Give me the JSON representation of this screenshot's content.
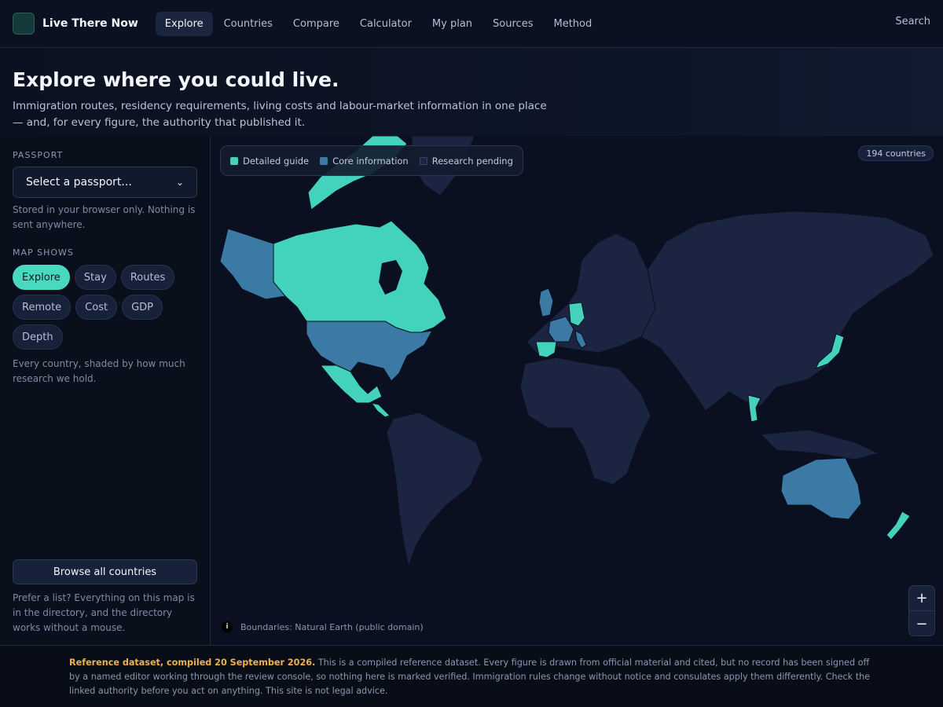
{
  "app": {
    "name": "Live There Now"
  },
  "nav": {
    "items": [
      {
        "label": "Explore",
        "active": true
      },
      {
        "label": "Countries",
        "active": false
      },
      {
        "label": "Compare",
        "active": false
      },
      {
        "label": "Calculator",
        "active": false
      },
      {
        "label": "My plan",
        "active": false
      },
      {
        "label": "Sources",
        "active": false
      },
      {
        "label": "Method",
        "active": false
      }
    ],
    "search_label": "Search"
  },
  "hero": {
    "title": "Explore where you could live.",
    "subtitle": "Immigration routes, residency requirements, living costs and labour-market information in one place — and, for every figure, the authority that published it."
  },
  "sidebar": {
    "passport_label": "PASSPORT",
    "passport_select": {
      "value": "Select a passport..."
    },
    "passport_note": "Stored in your browser only. Nothing is sent anywhere.",
    "map_shows_label": "MAP SHOWS",
    "modes": [
      {
        "label": "Explore",
        "active": true
      },
      {
        "label": "Stay",
        "active": false
      },
      {
        "label": "Routes",
        "active": false
      },
      {
        "label": "Remote",
        "active": false
      },
      {
        "label": "Cost",
        "active": false
      },
      {
        "label": "GDP",
        "active": false
      },
      {
        "label": "Depth",
        "active": false
      }
    ],
    "mode_note": "Every country, shaded by how much research we hold.",
    "browse_button": "Browse all countries",
    "browse_note": "Prefer a list? Everything on this map is in the directory, and the directory works without a mouse."
  },
  "map": {
    "legend": [
      {
        "label": "Detailed guide",
        "color": "#43d3bd"
      },
      {
        "label": "Core information",
        "color": "#3a7aa5"
      },
      {
        "label": "Research pending",
        "color": "#1b2440"
      }
    ],
    "country_count": "194 countries",
    "zoom_in": "+",
    "zoom_out": "−",
    "attribution": "Boundaries: Natural Earth (public domain)",
    "info_icon": "i",
    "icons": {
      "info": "info-icon",
      "zoom_in": "plus-icon",
      "zoom_out": "minus-icon",
      "select": "chevron-down-icon"
    }
  },
  "footer": {
    "title": "Reference dataset, compiled 20 September 2026.",
    "text": " This is a compiled reference dataset. Every figure is drawn from official material and cited, but no record has been signed off by a named editor working through the review console, so nothing here is marked verified. Immigration rules change without notice and consulates apply them differently. Check the linked authority before you act on anything. This site is not legal advice.",
    "title_color": "#f0b14b"
  }
}
